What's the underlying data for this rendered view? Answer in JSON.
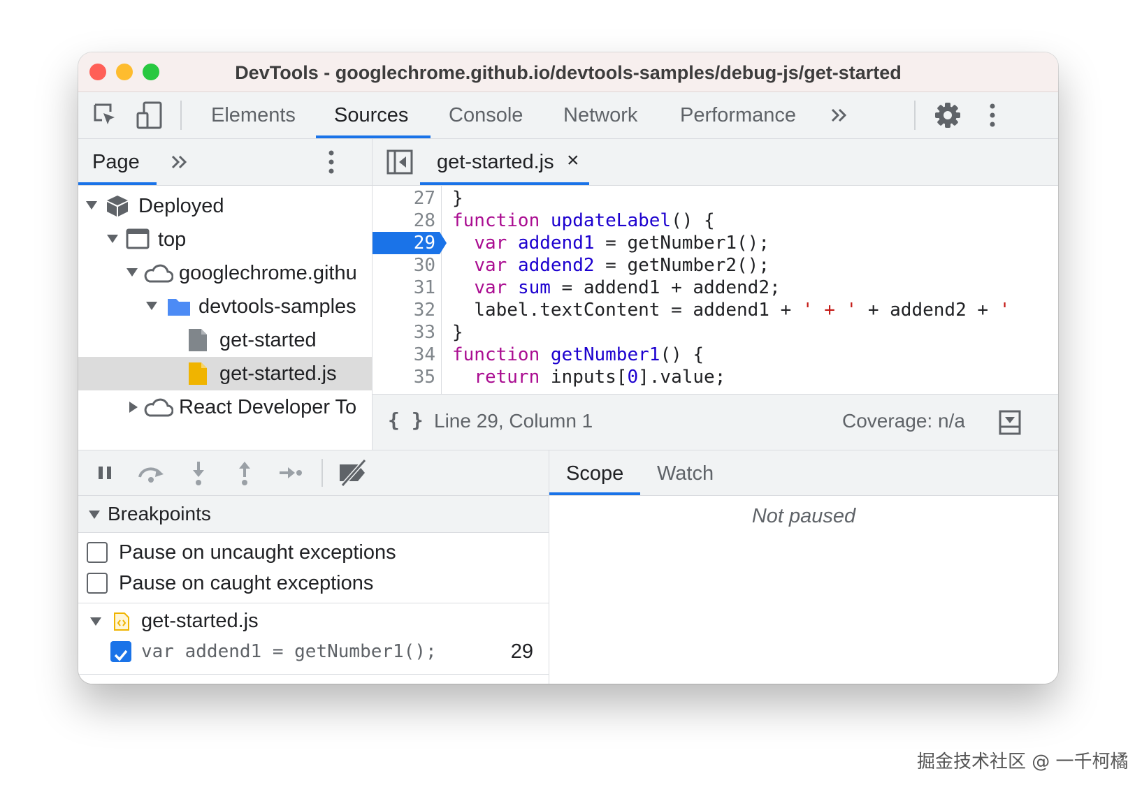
{
  "window": {
    "title": "DevTools - googlechrome.github.io/devtools-samples/debug-js/get-started",
    "traffic_lights": [
      "#ff5f57",
      "#febc2e",
      "#28c840"
    ]
  },
  "main_tabs": [
    {
      "label": "Elements"
    },
    {
      "label": "Sources"
    },
    {
      "label": "Console"
    },
    {
      "label": "Network"
    },
    {
      "label": "Performance"
    }
  ],
  "active_tab": "Sources",
  "accent_color": "#1a73e8",
  "navigator": {
    "tab_label": "Page",
    "tree": [
      {
        "label": "Deployed",
        "icon": "cube-icon"
      },
      {
        "label": "top",
        "icon": "frame-icon"
      },
      {
        "label": "googlechrome.githu",
        "icon": "cloud-icon"
      },
      {
        "label": "devtools-samples",
        "icon": "folder-icon"
      },
      {
        "label": "get-started",
        "icon": "document-icon"
      },
      {
        "label": "get-started.js",
        "icon": "js-file-icon"
      },
      {
        "label": "React Developer To",
        "icon": "cloud-icon"
      }
    ]
  },
  "editor": {
    "file_tab": "get-started.js",
    "close_glyph": "×",
    "breakpoint_line": "29",
    "lines": [
      {
        "n": "27",
        "parts": [
          {
            "t": "}",
            "c": ""
          }
        ]
      },
      {
        "n": "28",
        "parts": [
          {
            "t": "function",
            "c": "kw"
          },
          {
            "t": " ",
            "c": ""
          },
          {
            "t": "updateLabel",
            "c": "fn"
          },
          {
            "t": "() {",
            "c": ""
          }
        ]
      },
      {
        "n": "29",
        "parts": [
          {
            "t": "  ",
            "c": ""
          },
          {
            "t": "var",
            "c": "kw"
          },
          {
            "t": " ",
            "c": ""
          },
          {
            "t": "addend1",
            "c": "vr"
          },
          {
            "t": " = getNumber1();",
            "c": ""
          }
        ]
      },
      {
        "n": "30",
        "parts": [
          {
            "t": "  ",
            "c": ""
          },
          {
            "t": "var",
            "c": "kw"
          },
          {
            "t": " ",
            "c": ""
          },
          {
            "t": "addend2",
            "c": "vr"
          },
          {
            "t": " = getNumber2();",
            "c": ""
          }
        ]
      },
      {
        "n": "31",
        "parts": [
          {
            "t": "  ",
            "c": ""
          },
          {
            "t": "var",
            "c": "kw"
          },
          {
            "t": " ",
            "c": ""
          },
          {
            "t": "sum",
            "c": "vr"
          },
          {
            "t": " = addend1 + addend2;",
            "c": ""
          }
        ]
      },
      {
        "n": "32",
        "parts": [
          {
            "t": "  label.textContent = addend1 + ",
            "c": ""
          },
          {
            "t": "' + '",
            "c": "str"
          },
          {
            "t": " + addend2 + ",
            "c": ""
          },
          {
            "t": "'",
            "c": "str"
          }
        ]
      },
      {
        "n": "33",
        "parts": [
          {
            "t": "}",
            "c": ""
          }
        ]
      },
      {
        "n": "34",
        "parts": [
          {
            "t": "function",
            "c": "kw"
          },
          {
            "t": " ",
            "c": ""
          },
          {
            "t": "getNumber1",
            "c": "fn"
          },
          {
            "t": "() {",
            "c": ""
          }
        ]
      },
      {
        "n": "35",
        "parts": [
          {
            "t": "  ",
            "c": ""
          },
          {
            "t": "return",
            "c": "kw"
          },
          {
            "t": " inputs[",
            "c": ""
          },
          {
            "t": "0",
            "c": "num"
          },
          {
            "t": "].value;",
            "c": ""
          }
        ]
      }
    ],
    "status": {
      "pretty_print": "{ }",
      "position": "Line 29, Column 1",
      "coverage": "Coverage: n/a"
    }
  },
  "debugger": {
    "breakpoints_title": "Breakpoints",
    "pause_uncaught": "Pause on uncaught exceptions",
    "pause_caught": "Pause on caught exceptions",
    "bp_file": "get-started.js",
    "bp_code": "var addend1 = getNumber1();",
    "bp_line": "29"
  },
  "scope_panel": {
    "tabs": [
      {
        "label": "Scope"
      },
      {
        "label": "Watch"
      }
    ],
    "message": "Not paused"
  },
  "watermark": "掘金技术社区 @ 一千柯橘"
}
